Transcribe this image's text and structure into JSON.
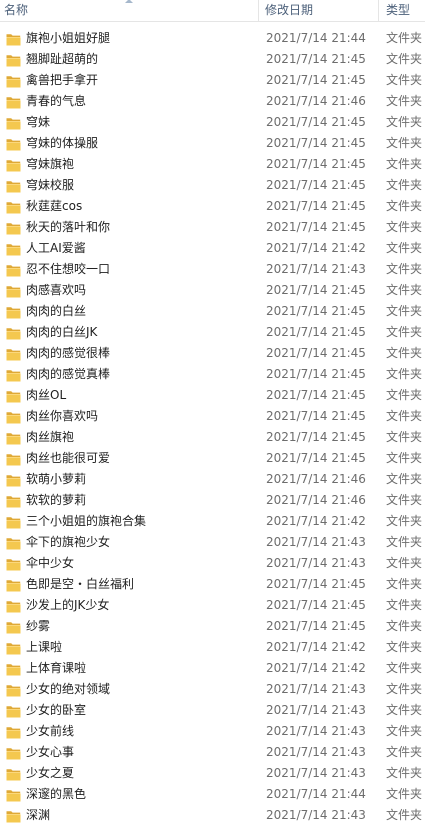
{
  "columns": {
    "name": "名称",
    "date": "修改日期",
    "type": "类型"
  },
  "colors": {
    "folder_body": "#f4c84f",
    "folder_back": "#dfa936",
    "header_text": "#4c607a"
  },
  "folder_icon": "folder-icon",
  "rows": [
    {
      "name": "旗袍小姐姐好腿",
      "date": "2021/7/14 21:44",
      "type": "文件夹"
    },
    {
      "name": "翘脚趾超萌的",
      "date": "2021/7/14 21:45",
      "type": "文件夹"
    },
    {
      "name": "禽兽把手拿开",
      "date": "2021/7/14 21:45",
      "type": "文件夹"
    },
    {
      "name": "青春的气息",
      "date": "2021/7/14 21:46",
      "type": "文件夹"
    },
    {
      "name": "穹妹",
      "date": "2021/7/14 21:45",
      "type": "文件夹"
    },
    {
      "name": "穹妹的体操服",
      "date": "2021/7/14 21:45",
      "type": "文件夹"
    },
    {
      "name": "穹妹旗袍",
      "date": "2021/7/14 21:45",
      "type": "文件夹"
    },
    {
      "name": "穹妹校服",
      "date": "2021/7/14 21:45",
      "type": "文件夹"
    },
    {
      "name": "秋莛莛cos",
      "date": "2021/7/14 21:45",
      "type": "文件夹"
    },
    {
      "name": "秋天的落叶和你",
      "date": "2021/7/14 21:45",
      "type": "文件夹"
    },
    {
      "name": "人工AI爱酱",
      "date": "2021/7/14 21:42",
      "type": "文件夹"
    },
    {
      "name": "忍不住想咬一口",
      "date": "2021/7/14 21:43",
      "type": "文件夹"
    },
    {
      "name": "肉感喜欢吗",
      "date": "2021/7/14 21:45",
      "type": "文件夹"
    },
    {
      "name": "肉肉的白丝",
      "date": "2021/7/14 21:45",
      "type": "文件夹"
    },
    {
      "name": "肉肉的白丝JK",
      "date": "2021/7/14 21:45",
      "type": "文件夹"
    },
    {
      "name": "肉肉的感觉很棒",
      "date": "2021/7/14 21:45",
      "type": "文件夹"
    },
    {
      "name": "肉肉的感觉真棒",
      "date": "2021/7/14 21:45",
      "type": "文件夹"
    },
    {
      "name": "肉丝OL",
      "date": "2021/7/14 21:45",
      "type": "文件夹"
    },
    {
      "name": "肉丝你喜欢吗",
      "date": "2021/7/14 21:45",
      "type": "文件夹"
    },
    {
      "name": "肉丝旗袍",
      "date": "2021/7/14 21:45",
      "type": "文件夹"
    },
    {
      "name": "肉丝也能很可爱",
      "date": "2021/7/14 21:45",
      "type": "文件夹"
    },
    {
      "name": "软萌小萝莉",
      "date": "2021/7/14 21:46",
      "type": "文件夹"
    },
    {
      "name": "软软的萝莉",
      "date": "2021/7/14 21:46",
      "type": "文件夹"
    },
    {
      "name": "三个小姐姐的旗袍合集",
      "date": "2021/7/14 21:42",
      "type": "文件夹"
    },
    {
      "name": "伞下的旗袍少女",
      "date": "2021/7/14 21:43",
      "type": "文件夹"
    },
    {
      "name": "伞中少女",
      "date": "2021/7/14 21:43",
      "type": "文件夹"
    },
    {
      "name": "色即是空・白丝福利",
      "date": "2021/7/14 21:45",
      "type": "文件夹"
    },
    {
      "name": "沙发上的JK少女",
      "date": "2021/7/14 21:45",
      "type": "文件夹"
    },
    {
      "name": "纱雾",
      "date": "2021/7/14 21:45",
      "type": "文件夹"
    },
    {
      "name": "上课啦",
      "date": "2021/7/14 21:42",
      "type": "文件夹"
    },
    {
      "name": "上体育课啦",
      "date": "2021/7/14 21:42",
      "type": "文件夹"
    },
    {
      "name": "少女的绝对领域",
      "date": "2021/7/14 21:43",
      "type": "文件夹"
    },
    {
      "name": "少女的卧室",
      "date": "2021/7/14 21:43",
      "type": "文件夹"
    },
    {
      "name": "少女前线",
      "date": "2021/7/14 21:43",
      "type": "文件夹"
    },
    {
      "name": "少女心事",
      "date": "2021/7/14 21:43",
      "type": "文件夹"
    },
    {
      "name": "少女之夏",
      "date": "2021/7/14 21:43",
      "type": "文件夹"
    },
    {
      "name": "深邃的黑色",
      "date": "2021/7/14 21:44",
      "type": "文件夹"
    },
    {
      "name": "深渊",
      "date": "2021/7/14 21:43",
      "type": "文件夹"
    }
  ]
}
